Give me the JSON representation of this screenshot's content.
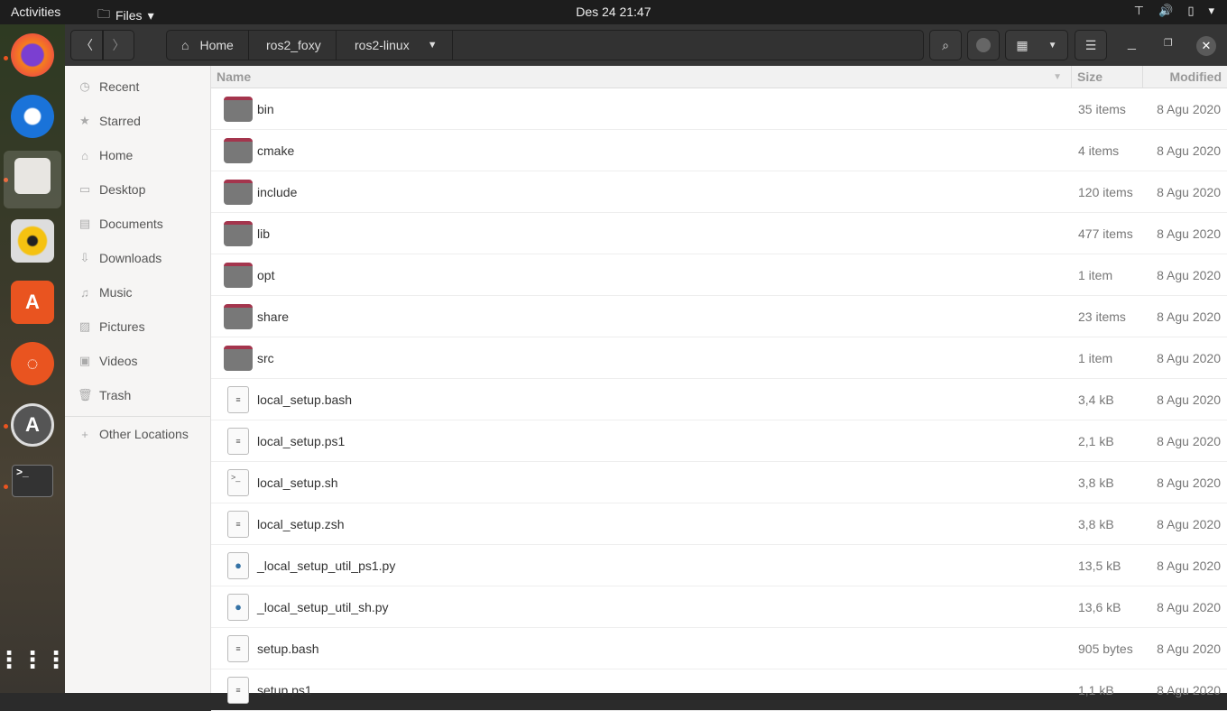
{
  "topbar": {
    "activities": "Activities",
    "app": "Files",
    "clock": "Des 24  21:47",
    "icons": [
      "network-icon",
      "volume-icon",
      "battery-icon",
      "system-menu-icon"
    ]
  },
  "dock": [
    "firefox",
    "thunderbird",
    "files",
    "rhythmbox",
    "software",
    "ubuntu",
    "updater",
    "terminal",
    "show-apps"
  ],
  "header": {
    "breadcrumbs": [
      "Home",
      "ros2_foxy",
      "ros2-linux"
    ]
  },
  "sidebar": {
    "items": [
      {
        "label": "Recent",
        "icon": "◷"
      },
      {
        "label": "Starred",
        "icon": "★"
      },
      {
        "label": "Home",
        "icon": "⌂"
      },
      {
        "label": "Desktop",
        "icon": "▭"
      },
      {
        "label": "Documents",
        "icon": "▤"
      },
      {
        "label": "Downloads",
        "icon": "⇩"
      },
      {
        "label": "Music",
        "icon": "♫"
      },
      {
        "label": "Pictures",
        "icon": "▨"
      },
      {
        "label": "Videos",
        "icon": "▣"
      },
      {
        "label": "Trash",
        "icon": "🗑"
      }
    ],
    "other": "Other Locations"
  },
  "columns": {
    "name": "Name",
    "size": "Size",
    "modified": "Modified"
  },
  "files": [
    {
      "name": "bin",
      "size": "35 items",
      "modified": "8 Agu 2020",
      "type": "folder"
    },
    {
      "name": "cmake",
      "size": "4 items",
      "modified": "8 Agu 2020",
      "type": "folder"
    },
    {
      "name": "include",
      "size": "120 items",
      "modified": "8 Agu 2020",
      "type": "folder"
    },
    {
      "name": "lib",
      "size": "477 items",
      "modified": "8 Agu 2020",
      "type": "folder"
    },
    {
      "name": "opt",
      "size": "1 item",
      "modified": "8 Agu 2020",
      "type": "folder"
    },
    {
      "name": "share",
      "size": "23 items",
      "modified": "8 Agu 2020",
      "type": "folder"
    },
    {
      "name": "src",
      "size": "1 item",
      "modified": "8 Agu 2020",
      "type": "folder"
    },
    {
      "name": "local_setup.bash",
      "size": "3,4 kB",
      "modified": "8 Agu 2020",
      "type": "text"
    },
    {
      "name": "local_setup.ps1",
      "size": "2,1 kB",
      "modified": "8 Agu 2020",
      "type": "text"
    },
    {
      "name": "local_setup.sh",
      "size": "3,8 kB",
      "modified": "8 Agu 2020",
      "type": "script"
    },
    {
      "name": "local_setup.zsh",
      "size": "3,8 kB",
      "modified": "8 Agu 2020",
      "type": "text"
    },
    {
      "name": "_local_setup_util_ps1.py",
      "size": "13,5 kB",
      "modified": "8 Agu 2020",
      "type": "python"
    },
    {
      "name": "_local_setup_util_sh.py",
      "size": "13,6 kB",
      "modified": "8 Agu 2020",
      "type": "python"
    },
    {
      "name": "setup.bash",
      "size": "905 bytes",
      "modified": "8 Agu 2020",
      "type": "text"
    },
    {
      "name": "setup.ps1",
      "size": "1,1 kB",
      "modified": "8 Agu 2020",
      "type": "text"
    }
  ]
}
